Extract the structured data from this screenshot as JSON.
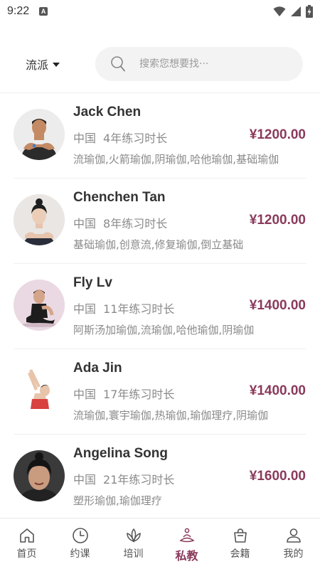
{
  "status_bar": {
    "time": "9:22",
    "a_badge": "A"
  },
  "header": {
    "filter_label": "流派",
    "search_placeholder": "搜索您想要找···"
  },
  "coaches": [
    {
      "name": "Jack Chen",
      "country": "中国",
      "experience": "4年练习时长",
      "price": "¥1200.00",
      "tags": "流瑜伽,火箭瑜伽,阴瑜伽,哈他瑜伽,基础瑜伽"
    },
    {
      "name": "Chenchen Tan",
      "country": "中国",
      "experience": "8年练习时长",
      "price": "¥1200.00",
      "tags": "基础瑜伽,创意流,修复瑜伽,倒立基础"
    },
    {
      "name": "Fly Lv",
      "country": "中国",
      "experience": "11年练习时长",
      "price": "¥1400.00",
      "tags": "阿斯汤加瑜伽,流瑜伽,哈他瑜伽,阴瑜伽"
    },
    {
      "name": "Ada Jin",
      "country": "中国",
      "experience": "17年练习时长",
      "price": "¥1400.00",
      "tags": "流瑜伽,寰宇瑜伽,热瑜伽,瑜伽理疗,阴瑜伽"
    },
    {
      "name": "Angelina Song",
      "country": "中国",
      "experience": "21年练习时长",
      "price": "¥1600.00",
      "tags": "塑形瑜伽,瑜伽理疗"
    }
  ],
  "tabs": [
    {
      "label": "首页",
      "icon": "home-icon"
    },
    {
      "label": "约课",
      "icon": "clock-icon"
    },
    {
      "label": "培训",
      "icon": "lotus-icon"
    },
    {
      "label": "私教",
      "icon": "meditation-icon",
      "active": true
    },
    {
      "label": "会籍",
      "icon": "bag-icon"
    },
    {
      "label": "我的",
      "icon": "user-icon"
    }
  ],
  "colors": {
    "accent": "#8a3a5c",
    "text": "#333333",
    "muted": "#8a8a8a",
    "search_bg": "#f3f3f3"
  }
}
